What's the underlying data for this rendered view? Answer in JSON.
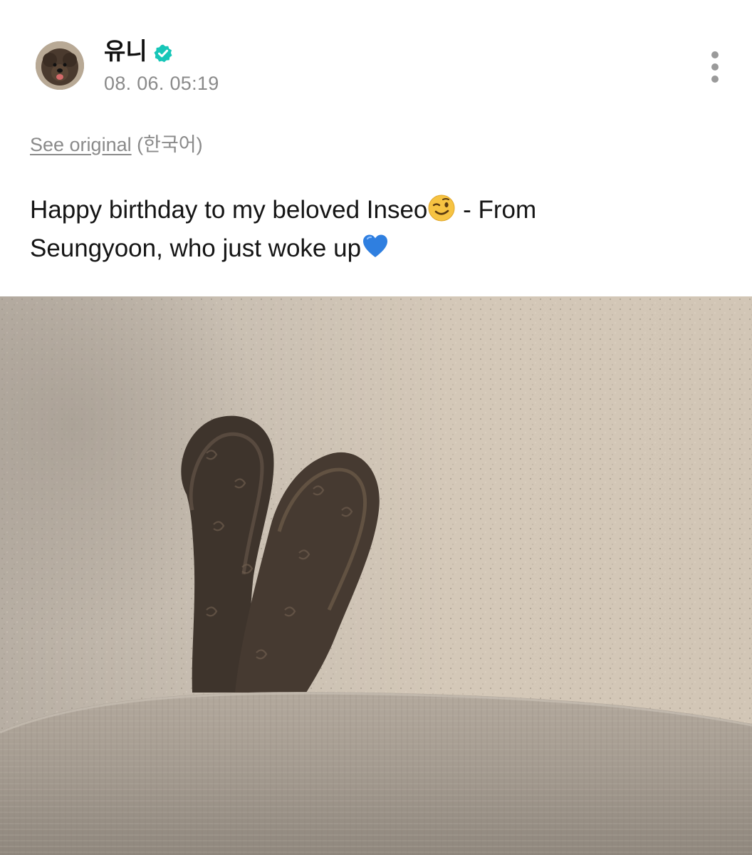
{
  "post": {
    "author": {
      "name": "유니",
      "verified": true,
      "avatar_icon": "dog-avatar-icon"
    },
    "timestamp": "08. 06. 05:19",
    "more_icon": "more-vertical-icon",
    "translation": {
      "see_original_label": "See original",
      "language_label": "(한국어)"
    },
    "text": {
      "line1": "Happy birthday to my beloved Inseo",
      "emoji1": "wink-face",
      "line1_after": " - From",
      "line2": "Seungyoon, who just woke up",
      "emoji2": "blue-heart"
    },
    "photo": {
      "icon": "dog-ears-photo"
    }
  },
  "colors": {
    "verified_badge": "#17c6b8",
    "secondary_text": "#8a8a8a",
    "primary_text": "#151515"
  }
}
